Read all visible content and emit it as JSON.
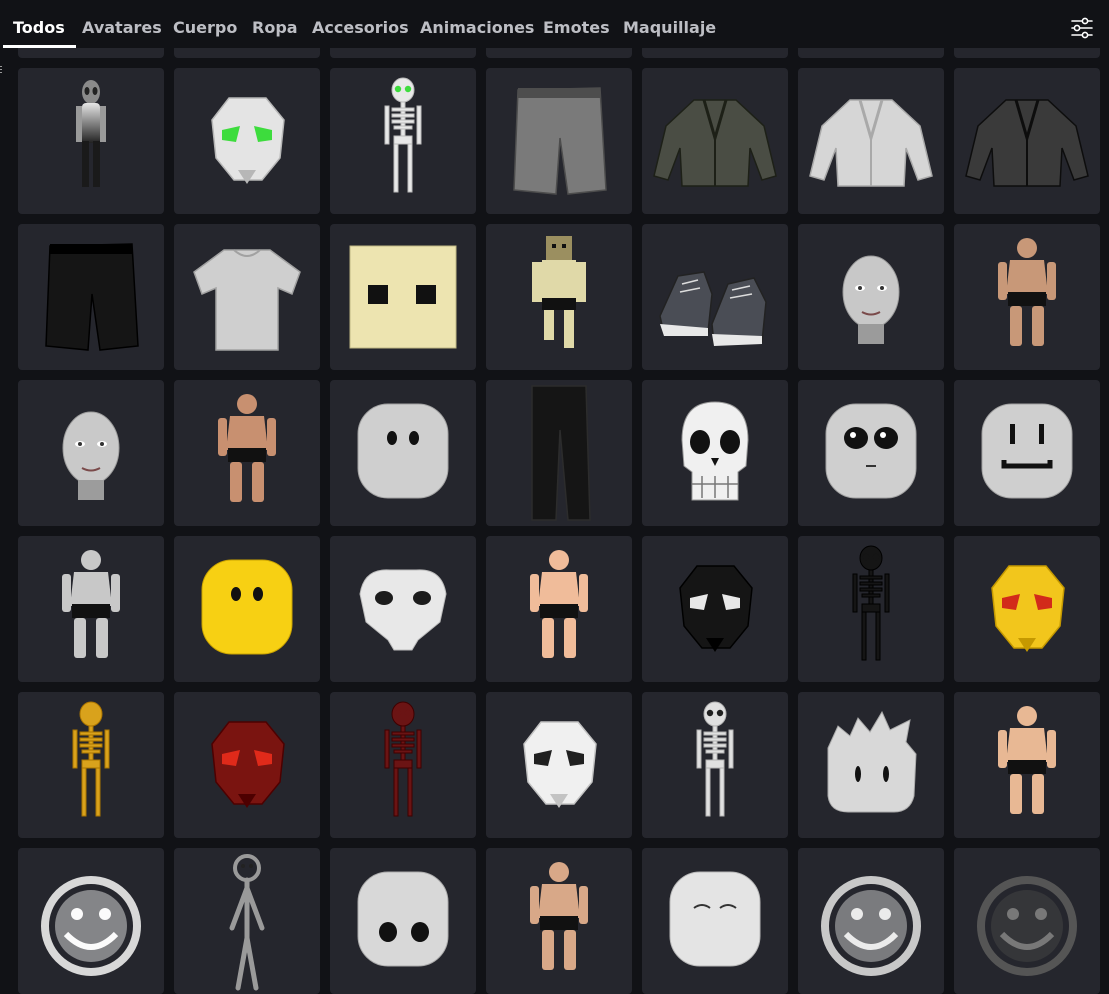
{
  "tabs": [
    {
      "label": "Todos",
      "active": true
    },
    {
      "label": "Avatares",
      "active": false
    },
    {
      "label": "Cuerpo",
      "active": false
    },
    {
      "label": "Ropa",
      "active": false
    },
    {
      "label": "Accesorios",
      "active": false
    },
    {
      "label": "Animaciones",
      "active": false
    },
    {
      "label": "Emotes",
      "active": false
    },
    {
      "label": "Maquillaje",
      "active": false
    }
  ],
  "filter_icon": "sliders-icon",
  "colors": {
    "background": "#111216",
    "tile": "#25262d",
    "active_tab": "#ffffff",
    "tab_text": "#bdbec4"
  },
  "items": [
    {
      "kind": "blank",
      "icon": "partial-item-icon"
    },
    {
      "kind": "blank",
      "icon": "partial-item-icon"
    },
    {
      "kind": "blank",
      "icon": "partial-item-icon"
    },
    {
      "kind": "blank",
      "icon": "partial-item-icon"
    },
    {
      "kind": "blank",
      "icon": "partial-item-icon"
    },
    {
      "kind": "blank",
      "icon": "partial-item-icon"
    },
    {
      "kind": "blank",
      "icon": "partial-item-icon"
    },
    {
      "kind": "alien",
      "icon": "alien-avatar-icon"
    },
    {
      "kind": "skullmask",
      "color": "#e4e4e4",
      "eye": "#3ddc3d",
      "icon": "skull-mask-green-eyes-icon"
    },
    {
      "kind": "skeleton",
      "color": "#e8e8e8",
      "eye": "#3ddc3d",
      "icon": "skeleton-green-eyes-icon"
    },
    {
      "kind": "shorts",
      "color": "#7a7a7a",
      "icon": "camo-shorts-icon"
    },
    {
      "kind": "jacket",
      "color": "#4a4d44",
      "icon": "olive-blazer-icon"
    },
    {
      "kind": "jacket",
      "color": "#d6d6d6",
      "icon": "white-leather-jacket-icon"
    },
    {
      "kind": "jacket",
      "color": "#3a3a3a",
      "icon": "dark-hooded-jacket-icon"
    },
    {
      "kind": "shorts",
      "color": "#151515",
      "icon": "black-shorts-icon"
    },
    {
      "kind": "tshirt",
      "color": "#cfcfcf",
      "icon": "white-tshirt-icon"
    },
    {
      "kind": "cubehead",
      "color": "#ede4b0",
      "icon": "square-head-icon"
    },
    {
      "kind": "blocky",
      "color": "#e0d9a8",
      "icon": "blocky-avatar-icon"
    },
    {
      "kind": "shoes",
      "color": "#4a4d55",
      "icon": "sneakers-icon"
    },
    {
      "kind": "realhead",
      "color": "#c8c8c8",
      "icon": "realistic-head-icon"
    },
    {
      "kind": "human",
      "color": "#c89878",
      "icon": "muscular-man-icon"
    },
    {
      "kind": "realhead",
      "color": "#c9c9c9",
      "icon": "smiling-head-icon"
    },
    {
      "kind": "human",
      "color": "#c89070",
      "icon": "bodybuilder-avatar-icon"
    },
    {
      "kind": "roundhead",
      "color": "#cfcfcf",
      "face": "dots",
      "icon": "classic-head-icon"
    },
    {
      "kind": "pants",
      "color": "#151515",
      "icon": "black-pants-icon"
    },
    {
      "kind": "skullface",
      "color": "#f0f0f0",
      "icon": "skull-head-icon"
    },
    {
      "kind": "roundhead",
      "color": "#cfcfcf",
      "face": "bigeyes",
      "icon": "cute-face-head-icon"
    },
    {
      "kind": "roundhead",
      "color": "#cfcfcf",
      "face": "smile",
      "icon": "smile-face-head-icon"
    },
    {
      "kind": "human",
      "color": "#c8c8c8",
      "icon": "muscle-block-avatar-icon"
    },
    {
      "kind": "roundhead",
      "color": "#f7d013",
      "face": "dots",
      "icon": "yellow-head-icon"
    },
    {
      "kind": "mask",
      "color": "#e8e8e8",
      "eye": "#1c1c1c",
      "icon": "white-mask-icon"
    },
    {
      "kind": "human",
      "color": "#f0bc9a",
      "icon": "bean-avatar-icon"
    },
    {
      "kind": "skullmask",
      "color": "#151515",
      "eye": "#e8e8e8",
      "icon": "black-skull-mask-icon"
    },
    {
      "kind": "skeleton",
      "color": "#151515",
      "eye": "#151515",
      "icon": "black-skeleton-icon"
    },
    {
      "kind": "skullmask",
      "color": "#f2c61c",
      "eye": "#d22a1a",
      "icon": "gold-skull-mask-icon"
    },
    {
      "kind": "skeleton",
      "color": "#d9a21c",
      "eye": "#d9a21c",
      "icon": "gold-skeleton-icon"
    },
    {
      "kind": "skullmask",
      "color": "#7a1410",
      "eye": "#e02a1a",
      "icon": "red-skull-mask-icon"
    },
    {
      "kind": "skeleton",
      "color": "#6b1414",
      "eye": "#6b1414",
      "icon": "red-skeleton-icon"
    },
    {
      "kind": "skullmask",
      "color": "#f0f0f0",
      "eye": "#202020",
      "icon": "white-skull-mask-icon"
    },
    {
      "kind": "skeleton",
      "color": "#e0e0e0",
      "eye": "#202020",
      "icon": "white-skeleton-icon"
    },
    {
      "kind": "spiky",
      "color": "#d8d8d8",
      "icon": "spiky-hair-head-icon"
    },
    {
      "kind": "human",
      "color": "#e8b894",
      "icon": "blocky-kid-avatar-icon"
    },
    {
      "kind": "smiley",
      "color": "#d8d8d8",
      "icon": "smiley-ring-icon"
    },
    {
      "kind": "stick",
      "color": "#9a9a9a",
      "icon": "stick-figure-icon"
    },
    {
      "kind": "roundhead",
      "color": "#d8d8d8",
      "face": "bigdots",
      "icon": "big-eyes-head-icon"
    },
    {
      "kind": "human",
      "color": "#d8a888",
      "icon": "tan-avatar-icon"
    },
    {
      "kind": "roundhead",
      "color": "#e4e4e4",
      "face": "sleepy",
      "icon": "sleepy-head-icon"
    },
    {
      "kind": "smiley",
      "color": "#c8c8c8",
      "icon": "chrome-smiley-ring-icon"
    },
    {
      "kind": "smiley",
      "color": "#555555",
      "icon": "dark-smiley-ring-icon"
    }
  ]
}
